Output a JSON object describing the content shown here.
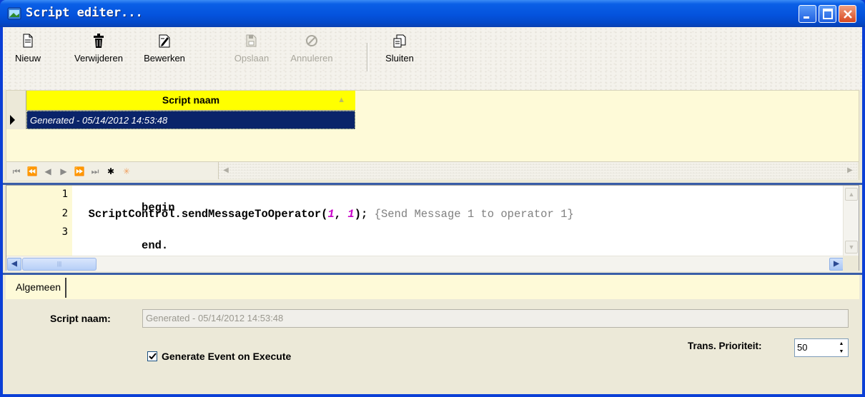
{
  "window": {
    "title": "Script editer...",
    "colors": {
      "titlebar": "#0453dd",
      "grid_header": "#ffff00",
      "selected_row": "#0a246a",
      "panel_bg": "#fefad8"
    }
  },
  "toolbar": {
    "items": [
      {
        "label": "Nieuw",
        "icon": "new-document-icon",
        "enabled": true
      },
      {
        "label": "Verwijderen",
        "icon": "trash-icon",
        "enabled": true
      },
      {
        "label": "Bewerken",
        "icon": "edit-icon",
        "enabled": true
      },
      {
        "label": "Opslaan",
        "icon": "save-icon",
        "enabled": false
      },
      {
        "label": "Annuleren",
        "icon": "cancel-icon",
        "enabled": false
      },
      {
        "label": "Sluiten",
        "icon": "close-document-icon",
        "enabled": true
      }
    ]
  },
  "grid": {
    "column_header": "Script naam",
    "rows": [
      "Generated - 05/14/2012 14:53:48"
    ]
  },
  "editor": {
    "line_numbers": [
      "1",
      "2",
      "3"
    ],
    "lines": {
      "l1_keyword": "begin",
      "l2_call": "ScriptControl.sendMessageToOperator",
      "l2_open": "(",
      "l2_arg1": "1",
      "l2_sep": ", ",
      "l2_arg2": "1",
      "l2_close": ");",
      "l2_comment": "{Send Message 1 to operator 1}",
      "l3_keyword": "end",
      "l3_dot": "."
    }
  },
  "tabs": {
    "active": "Algemeen"
  },
  "form": {
    "script_name_label": "Script naam:",
    "script_name_value": "Generated - 05/14/2012 14:53:48",
    "generate_event_label": "Generate Event on Execute",
    "generate_event_checked": true,
    "priority_label": "Trans. Prioriteit:",
    "priority_value": "50"
  }
}
